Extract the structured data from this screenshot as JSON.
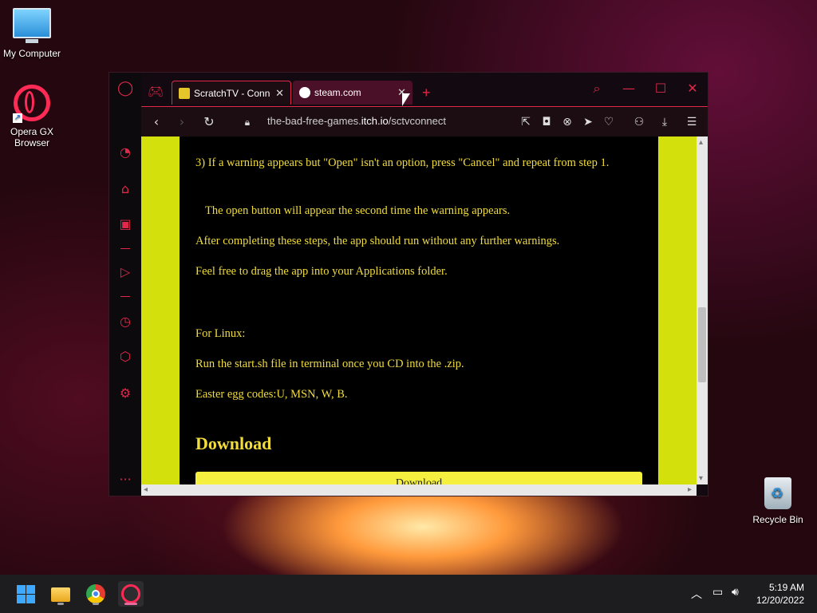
{
  "desktop": {
    "icons": [
      {
        "label": "My Computer",
        "icon": "computer-icon"
      },
      {
        "label": "Opera GX Browser",
        "icon": "opera-gx-icon"
      },
      {
        "label": "Recycle Bin",
        "icon": "recycle-bin-icon"
      }
    ]
  },
  "browser": {
    "tabs": [
      {
        "title": "ScratchTV - Conne",
        "close": "✕",
        "state": "active"
      },
      {
        "title": "steam.com",
        "close": "✕",
        "state": "inactive"
      }
    ],
    "new_tab": "+",
    "url": {
      "prefix": "the-bad-free-games.",
      "domain": "itch.io",
      "path": "/sctvconnect"
    },
    "window_controls": {
      "search": "⌕",
      "minimize": "—",
      "maximize": "☐",
      "close": "✕"
    },
    "sidebar_more": "···"
  },
  "page": {
    "paragraphs": [
      "3) If a warning appears but \"Open\" isn't an option, press \"Cancel\" and repeat from step 1.",
      "The open button will appear the second time the warning appears.",
      "After completing these steps, the app should run without any further warnings.",
      "Feel free to drag the app into your Applications folder.",
      "For Linux:",
      "Run the start.sh file in terminal once you CD into the .zip.",
      "Easter egg codes:U, MSN, W, B."
    ],
    "download_heading": "Download",
    "download_button": "Download"
  },
  "taskbar": {
    "apps": [
      "start-button",
      "file-explorer",
      "google-chrome",
      "opera-gx"
    ],
    "clock": {
      "time": "5:19 AM",
      "date": "12/20/2022"
    }
  },
  "colors": {
    "accent": "#e0284b",
    "page_bg": "#d4e00b",
    "content_bg": "#000000",
    "text": "#f1dc3c"
  }
}
